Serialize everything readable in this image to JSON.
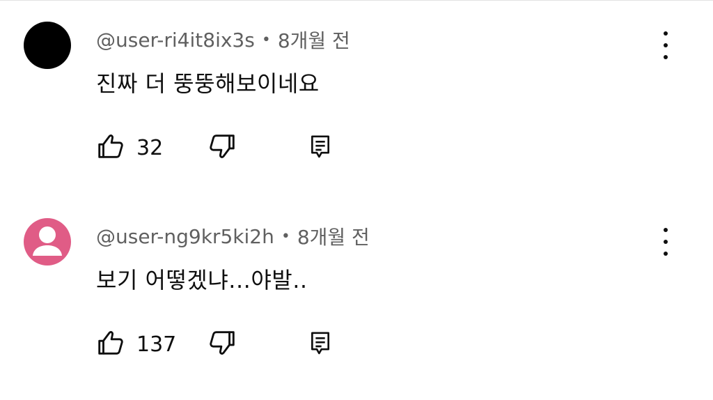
{
  "comments": [
    {
      "handle": "@user-ri4it8ix3s",
      "separator": "•",
      "time": "8개월 전",
      "text": "진짜 더 뚱뚱해보이네요",
      "likes": "32",
      "avatar_color": "#000000"
    },
    {
      "handle": "@user-ng9kr5ki2h",
      "separator": "•",
      "time": "8개월 전",
      "text": "보기 어떻겠냐...야발..",
      "likes": "137",
      "avatar_color": "#e05c86"
    }
  ],
  "icons": {
    "like": "thumb-up-icon",
    "dislike": "thumb-down-icon",
    "reply": "reply-icon",
    "menu": "more-vert-icon"
  }
}
